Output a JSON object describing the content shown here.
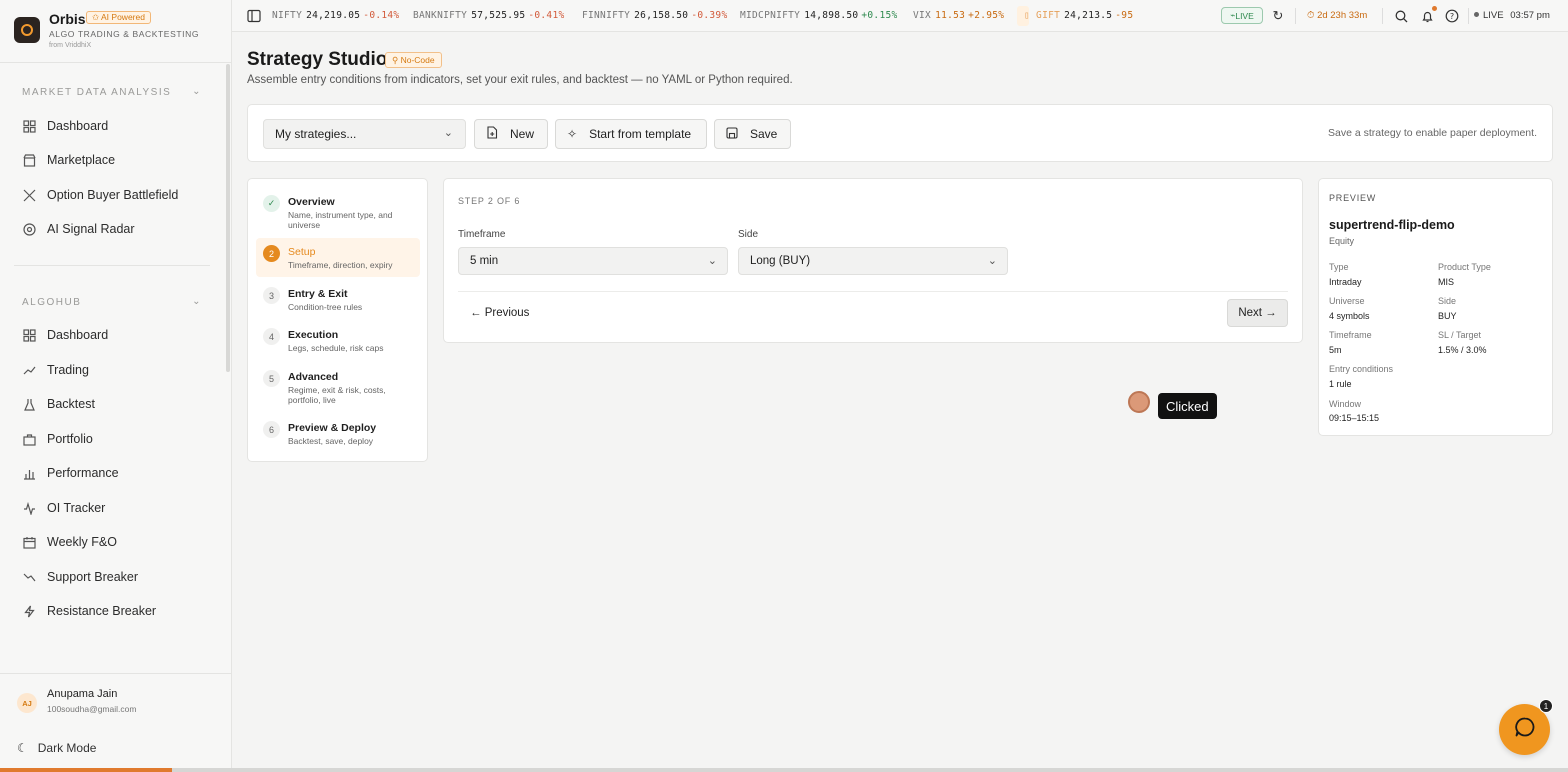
{
  "brand": {
    "name": "Orbis",
    "badge": "AI Powered",
    "tagline": "ALGO TRADING & BACKTESTING",
    "from": "from VriddhiX"
  },
  "sidebar": {
    "section1": "MARKET DATA ANALYSIS",
    "items1": [
      {
        "label": "Dashboard",
        "icon": "grid-icon"
      },
      {
        "label": "Marketplace",
        "icon": "store-icon"
      },
      {
        "label": "Option Buyer Battlefield",
        "icon": "swords-icon"
      },
      {
        "label": "AI Signal Radar",
        "icon": "radar-icon"
      }
    ],
    "section2": "ALGOHUB",
    "items2": [
      {
        "label": "Dashboard",
        "icon": "grid-icon"
      },
      {
        "label": "Trading",
        "icon": "trend-icon"
      },
      {
        "label": "Backtest",
        "icon": "flask-icon"
      },
      {
        "label": "Portfolio",
        "icon": "briefcase-icon"
      },
      {
        "label": "Performance",
        "icon": "chart-icon"
      },
      {
        "label": "OI Tracker",
        "icon": "pulse-icon"
      },
      {
        "label": "Weekly F&O",
        "icon": "calendar-icon"
      },
      {
        "label": "Support Breaker",
        "icon": "trend-down-icon"
      },
      {
        "label": "Resistance Breaker",
        "icon": "zap-icon"
      }
    ],
    "user": {
      "initials": "AJ",
      "name": "Anupama Jain",
      "email": "100soudha@gmail.com"
    },
    "dark_mode": "Dark Mode"
  },
  "ticker": {
    "nifty": {
      "sym": "NIFTY",
      "val": "24,219.05",
      "chg": "-0.14%"
    },
    "banknifty": {
      "sym": "BANKNIFTY",
      "val": "57,525.95",
      "chg": "-0.41%"
    },
    "finnifty": {
      "sym": "FINNIFTY",
      "val": "26,158.50",
      "chg": "-0.39%"
    },
    "midcpnifty": {
      "sym": "MIDCPNIFTY",
      "val": "14,898.50",
      "chg": "+0.15%"
    },
    "vix": {
      "sym": "VIX",
      "val": "11.53",
      "chg": "+2.95%"
    },
    "gift": {
      "sym": "GIFT",
      "val": "24,213.5",
      "chg": "-95"
    },
    "live_pill": "LIVE",
    "timer": "2d 23h 33m",
    "live_status": "LIVE",
    "time": "03:57 pm"
  },
  "header": {
    "title": "Strategy Studio",
    "badge": "No-Code",
    "subtitle": "Assemble entry conditions from indicators, set your exit rules, and backtest — no YAML or Python required."
  },
  "toolbar": {
    "select_value": "My strategies...",
    "new_label": "New",
    "template_label": "Start from template",
    "save_label": "Save",
    "hint": "Save a strategy to enable paper deployment."
  },
  "steps": [
    {
      "num": "✓",
      "title": "Overview",
      "desc": "Name, instrument type, and universe"
    },
    {
      "num": "2",
      "title": "Setup",
      "desc": "Timeframe, direction, expiry"
    },
    {
      "num": "3",
      "title": "Entry & Exit",
      "desc": "Condition-tree rules"
    },
    {
      "num": "4",
      "title": "Execution",
      "desc": "Legs, schedule, risk caps"
    },
    {
      "num": "5",
      "title": "Advanced",
      "desc": "Regime, exit & risk, costs, portfolio, live"
    },
    {
      "num": "6",
      "title": "Preview & Deploy",
      "desc": "Backtest, save, deploy"
    }
  ],
  "form": {
    "step_label": "STEP 2 OF 6",
    "timeframe_label": "Timeframe",
    "timeframe_value": "5 min",
    "side_label": "Side",
    "side_value": "Long (BUY)",
    "prev_label": "← Previous",
    "next_label": "Next →"
  },
  "click_marker": {
    "label": "Clicked"
  },
  "preview": {
    "heading": "PREVIEW",
    "name": "supertrend-flip-demo",
    "kind": "Equity",
    "type_k": "Type",
    "type_v": "Intraday",
    "product_k": "Product Type",
    "product_v": "MIS",
    "universe_k": "Universe",
    "universe_v": "4 symbols",
    "side_k": "Side",
    "side_v": "BUY",
    "timeframe_k": "Timeframe",
    "timeframe_v": "5m",
    "sltarget_k": "SL / Target",
    "sltarget_v": "1.5% / 3.0%",
    "entry_k": "Entry conditions",
    "entry_v": "1 rule",
    "window_k": "Window",
    "window_v": "09:15–15:15"
  },
  "chat": {
    "badge": "1"
  },
  "colors": {
    "accent": "#e58a1f",
    "negative": "#d25a3a",
    "positive": "#2f8a4f"
  },
  "page_progress": 0.11
}
